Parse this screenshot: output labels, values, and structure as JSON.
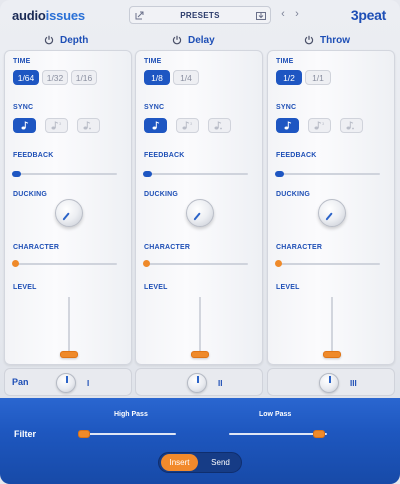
{
  "header": {
    "logo_part1": "audio",
    "logo_part2": "issues",
    "presets_label": "PRESETS",
    "prev_arrow": "‹",
    "next_arrow": "›",
    "brand": "3peat"
  },
  "columns": [
    {
      "title": "Depth",
      "time_label": "TIME",
      "time_options": [
        "1/64",
        "1/32",
        "1/16"
      ],
      "time_selected": 0,
      "sync_label": "SYNC",
      "feedback_label": "FEEDBACK",
      "feedback_value": 0,
      "ducking_label": "DUCKING",
      "character_label": "CHARACTER",
      "character_value": 0,
      "level_label": "LEVEL",
      "pan_number": "I"
    },
    {
      "title": "Delay",
      "time_label": "TIME",
      "time_options": [
        "1/8",
        "1/4"
      ],
      "time_selected": 0,
      "sync_label": "SYNC",
      "feedback_label": "FEEDBACK",
      "feedback_value": 0,
      "ducking_label": "DUCKING",
      "character_label": "CHARACTER",
      "character_value": 0,
      "level_label": "LEVEL",
      "pan_number": "II"
    },
    {
      "title": "Throw",
      "time_label": "TIME",
      "time_options": [
        "1/2",
        "1/1"
      ],
      "time_selected": 0,
      "sync_label": "SYNC",
      "feedback_label": "FEEDBACK",
      "feedback_value": 0,
      "ducking_label": "DUCKING",
      "character_label": "CHARACTER",
      "character_value": 0,
      "level_label": "LEVEL",
      "pan_number": "III"
    }
  ],
  "pan_label": "Pan",
  "filter": {
    "label": "Filter",
    "high_pass_label": "High Pass",
    "low_pass_label": "Low Pass"
  },
  "mode_toggle": {
    "options": [
      "Insert",
      "Send"
    ],
    "selected": "Insert"
  },
  "colors": {
    "accent_blue": "#1e56c2",
    "accent_orange": "#ef8a2a",
    "footer_blue": "#1e57bf"
  }
}
